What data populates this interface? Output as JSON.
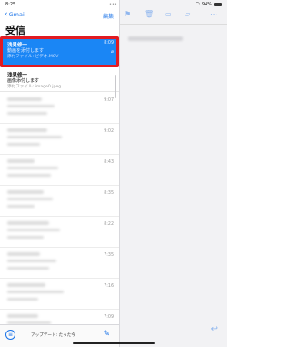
{
  "status_bar": {
    "time": "8:25",
    "dots": "•••",
    "wifi_icon": "wifi-icon",
    "battery_percent": "94%",
    "battery_level": 0.94
  },
  "sidebar": {
    "back_label": "Gmail",
    "edit_label": "編集",
    "title": "受信"
  },
  "mails": [
    {
      "sender": "浅見修一",
      "subject": "動画を添付します",
      "attachment": "添付ファイル: ビデオ.MOV",
      "time": "8:09",
      "selected": true
    },
    {
      "sender": "浅見修一",
      "subject": "画像添付します",
      "attachment": "添付ファイル: image0.jpeg",
      "time": "",
      "selected": false
    }
  ],
  "blurred_times": [
    "9:07",
    "9:02",
    "8:43",
    "8:35",
    "8:22",
    "7:35",
    "7:16",
    "7:09"
  ],
  "bottom_bar": {
    "update_status": "アップデート: たった今",
    "filter_icon": "filter-icon",
    "compose_icon": "compose-icon"
  },
  "detail": {
    "toolbar_icons": [
      "flag-icon",
      "trash-icon",
      "archive-icon",
      "folder-icon",
      "more-icon"
    ],
    "reply_icon": "reply-icon"
  },
  "colors": {
    "accent": "#1a73e8",
    "selected_row": "#1a86f5",
    "highlight_border": "#e21b22"
  }
}
